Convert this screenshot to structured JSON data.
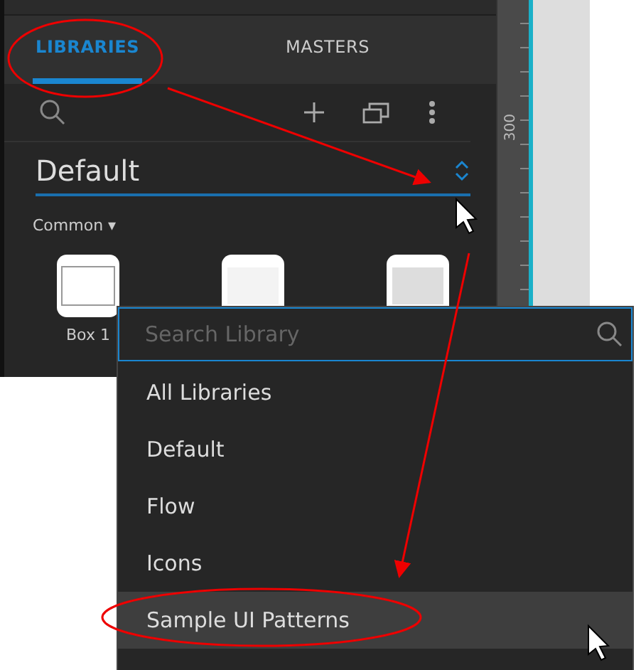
{
  "tabs": [
    {
      "label": "LIBRARIES",
      "selected": true
    },
    {
      "label": "MASTERS",
      "selected": false
    }
  ],
  "library_select": {
    "value": "Default"
  },
  "group": {
    "label": "Common ▾"
  },
  "widgets": [
    {
      "kind": "box",
      "label": "Box 1"
    },
    {
      "kind": "plain"
    },
    {
      "kind": "shaded"
    }
  ],
  "ruler": {
    "label": "300"
  },
  "dropdown": {
    "search": {
      "placeholder": "Search Library"
    },
    "options": [
      {
        "label": "All Libraries",
        "highlighted": false
      },
      {
        "label": "Default",
        "highlighted": false
      },
      {
        "label": "Flow",
        "highlighted": false
      },
      {
        "label": "Icons",
        "highlighted": false
      },
      {
        "label": "Sample UI Patterns",
        "highlighted": true
      }
    ]
  }
}
